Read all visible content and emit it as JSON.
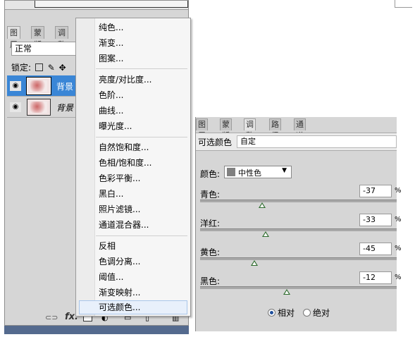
{
  "layers_panel": {
    "tabs": [
      "图层",
      "蒙版",
      "调整"
    ],
    "blend_mode": "正常",
    "lock_label": "锁定:",
    "layers": [
      {
        "name": "背景 副",
        "selected": true
      },
      {
        "name": "背景",
        "selected": false
      }
    ],
    "bottom_icons": [
      "link-icon",
      "fx-icon",
      "mask-icon",
      "adjustment-icon",
      "folder-icon",
      "new-layer-icon",
      "trash-icon"
    ],
    "fx_label": "fx."
  },
  "menu": {
    "groups": [
      [
        "纯色...",
        "渐变...",
        "图案..."
      ],
      [
        "亮度/对比度...",
        "色阶...",
        "曲线...",
        "曝光度..."
      ],
      [
        "自然饱和度...",
        "色相/饱和度...",
        "色彩平衡...",
        "黑白...",
        "照片滤镜...",
        "通道混合器..."
      ],
      [
        "反相",
        "色调分离...",
        "阈值...",
        "渐变映射...",
        "可选颜色..."
      ]
    ],
    "highlighted": "可选颜色..."
  },
  "adjust_panel": {
    "tabs": [
      "图层",
      "蒙版",
      "调整",
      "路径",
      "通道"
    ],
    "active_tab": "调整",
    "title": "可选颜色",
    "preset": "自定",
    "color_label": "颜色:",
    "color_value": "中性色",
    "color_swatch": "#808080",
    "sliders": [
      {
        "label": "青色:",
        "value": "-37",
        "level": -37
      },
      {
        "label": "洋红:",
        "value": "-33",
        "level": -33
      },
      {
        "label": "黄色:",
        "value": "-45",
        "level": -45
      },
      {
        "label": "黑色:",
        "value": "-12",
        "level": -12
      }
    ],
    "unit": "%",
    "method_relative": "相对",
    "method_absolute": "绝对",
    "method_selected": "relative"
  },
  "colors": {
    "selection": "#3a86d6",
    "statusbar": "#546a8e",
    "knob": "#2d6b2d"
  }
}
